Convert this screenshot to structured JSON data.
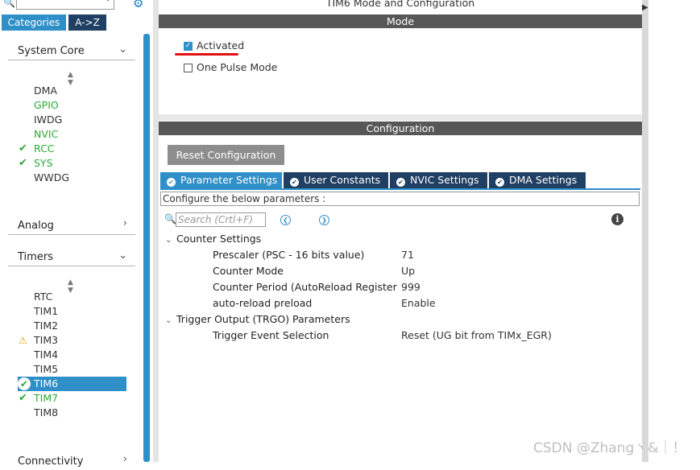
{
  "left": {
    "search_placeholder": "",
    "tabs": {
      "categories": "Categories",
      "az": "A->Z"
    },
    "system_core": {
      "header": "System Core",
      "items": [
        {
          "label": "DMA",
          "state": "none"
        },
        {
          "label": "GPIO",
          "state": "green"
        },
        {
          "label": "IWDG",
          "state": "none"
        },
        {
          "label": "NVIC",
          "state": "green"
        },
        {
          "label": "RCC",
          "state": "check"
        },
        {
          "label": "SYS",
          "state": "check"
        },
        {
          "label": "WWDG",
          "state": "none"
        }
      ]
    },
    "analog": {
      "header": "Analog"
    },
    "timers": {
      "header": "Timers",
      "items": [
        {
          "label": "RTC",
          "state": "none"
        },
        {
          "label": "TIM1",
          "state": "none"
        },
        {
          "label": "TIM2",
          "state": "none"
        },
        {
          "label": "TIM3",
          "state": "warning"
        },
        {
          "label": "TIM4",
          "state": "none"
        },
        {
          "label": "TIM5",
          "state": "none"
        },
        {
          "label": "TIM6",
          "state": "selected"
        },
        {
          "label": "TIM7",
          "state": "check"
        },
        {
          "label": "TIM8",
          "state": "none"
        }
      ]
    },
    "connectivity": {
      "header": "Connectivity"
    }
  },
  "main": {
    "title": "TIM6 Mode and Configuration",
    "mode_bar": "Mode",
    "activated": {
      "label": "Activated",
      "checked": true
    },
    "one_pulse": {
      "label": "One Pulse Mode",
      "checked": false
    },
    "config_bar": "Configuration",
    "reset_button": "Reset Configuration",
    "tabs": [
      "Parameter Settings",
      "User Constants",
      "NVIC Settings",
      "DMA Settings"
    ],
    "configure_hint": "Configure the below parameters :",
    "search_placeholder": "Search (Crtl+F)",
    "groups": {
      "counter": {
        "title": "Counter Settings",
        "params": [
          {
            "name": "Prescaler (PSC - 16 bits value)",
            "value": "71"
          },
          {
            "name": "Counter Mode",
            "value": "Up"
          },
          {
            "name": "Counter Period (AutoReload Register ...",
            "value": "999"
          },
          {
            "name": "auto-reload preload",
            "value": "Enable"
          }
        ]
      },
      "trigger": {
        "title": "Trigger Output (TRGO) Parameters",
        "params": [
          {
            "name": "Trigger Event Selection",
            "value": "Reset (UG bit from TIMx_EGR)"
          }
        ]
      }
    }
  },
  "watermark": "CSDN @Zhang丶&｜！",
  "colors": {
    "accent": "#2f8fc8",
    "dark_tab": "#1f3f63",
    "bar": "#575757",
    "green": "#2ea836",
    "underline": "#e01010"
  }
}
